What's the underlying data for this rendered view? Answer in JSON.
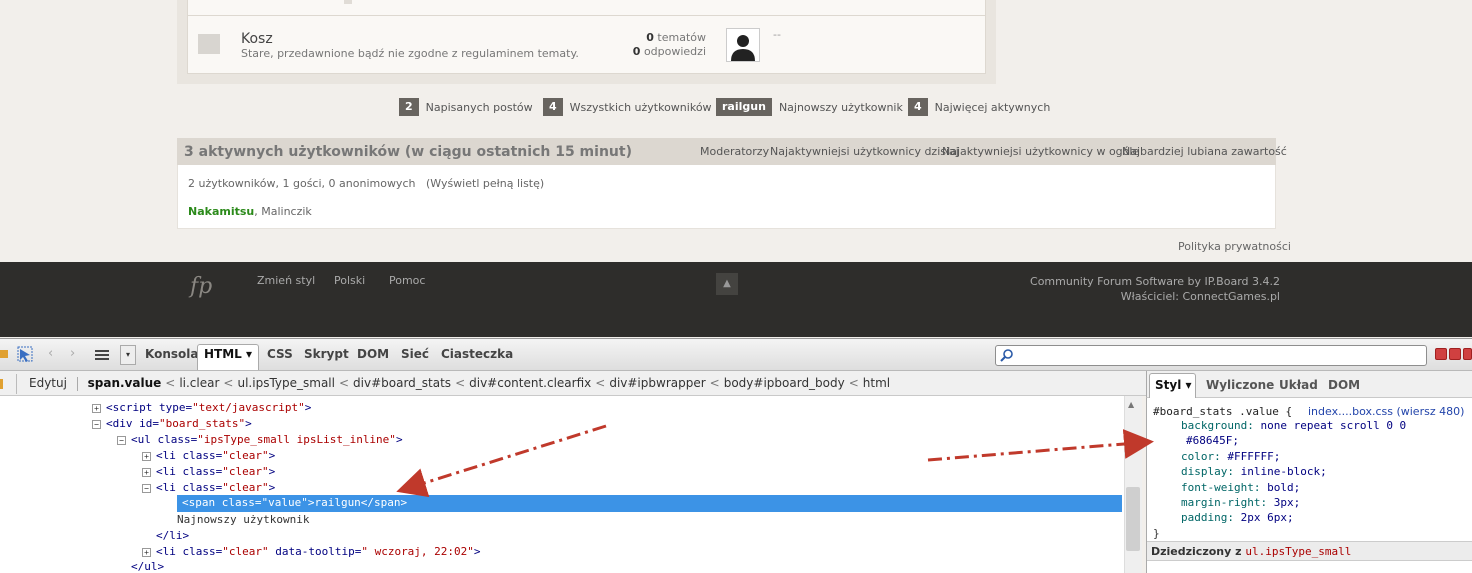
{
  "category": {
    "title": "Kosz",
    "description": "Stare, przedawnione bądź nie zgodne z regulaminem tematy.",
    "topics_count": "0",
    "topics_label": "tematów",
    "replies_count": "0",
    "replies_label": "odpowiedzi",
    "last_post": "--"
  },
  "board_stats": [
    {
      "value": "2",
      "label": "Napisanych postów"
    },
    {
      "value": "4",
      "label": "Wszystkich użytkowników"
    },
    {
      "value": "railgun",
      "label": "Najnowszy użytkownik"
    },
    {
      "value": "4",
      "label": "Najwięcej aktywnych"
    }
  ],
  "active_users": {
    "title": "3 aktywnych użytkowników (w ciągu ostatnich 15 minut)",
    "links": [
      "Moderatorzy",
      "Najaktywniejsi użytkownicy dzisiaj",
      "Najaktywniejsi użytkownicy w ogóle",
      "Najbardziej lubiana zawartość"
    ],
    "count_text": "2 użytkowników, 1 gości, 0 anonimowych",
    "full_list": "(Wyświetl pełną listę)",
    "user1": "Nakamitsu",
    "user2": ", Malinczik"
  },
  "privacy": "Polityka prywatności",
  "footer": {
    "logo": "fp",
    "change_style": "Zmień styl",
    "language": "Polski",
    "help": "Pomoc",
    "top_glyph": "▲",
    "software": "Community Forum Software by IP.Board 3.4.2",
    "owner": "Właściciel: ConnectGames.pl"
  },
  "firebug": {
    "tabs": {
      "console": "Konsola",
      "html": "HTML ▾",
      "css": "CSS",
      "script": "Skrypt",
      "dom": "DOM",
      "net": "Sieć",
      "cookies": "Ciasteczka"
    },
    "edit": "Edytuj",
    "breadcrumb": [
      "span.value",
      "li.clear",
      "ul.ipsType_small",
      "div#board_stats",
      "div#content.clearfix",
      "div#ipbwrapper",
      "body#ipboard_body",
      "html"
    ],
    "side_tabs": {
      "style": "Styl ▾",
      "computed": "Wyliczone",
      "layout": "Układ",
      "dom": "DOM"
    },
    "rule_selector": "#board_stats .value {",
    "rule_source": "index....box.css (wiersz 480)",
    "props": [
      {
        "name": "background:",
        "value": "none repeat scroll 0 0"
      },
      {
        "name": "",
        "value": "#68645F;"
      },
      {
        "name": "color:",
        "value": "#FFFFFF;"
      },
      {
        "name": "display:",
        "value": "inline-block;"
      },
      {
        "name": "font-weight:",
        "value": "bold;"
      },
      {
        "name": "margin-right:",
        "value": "3px;"
      },
      {
        "name": "padding:",
        "value": "2px 6px;"
      }
    ],
    "rule_close": "}",
    "inherited_label": "Dziedziczony z",
    "inherited_from": "ul.ipsType_small",
    "code": {
      "l1_tag": "<script",
      "l1_attr": "type=",
      "l1_val": "\"text/javascript\"",
      "l1_end": ">",
      "l2_tag": "<div",
      "l2_attr": "id=",
      "l2_val": "\"board_stats\"",
      "l2_end": ">",
      "l3_tag": "<ul",
      "l3_attr": "class=",
      "l3_val": "\"ipsType_small ipsList_inline\"",
      "l3_end": ">",
      "li_tag": "<li",
      "li_attr": "class=",
      "li_val": "\"clear\"",
      "li_end": ">",
      "span_line": "<span class=\"value\">railgun</span>",
      "text_line": "Najnowszy użytkownik",
      "li_close": "</li>",
      "l8_tooltip_attr": "data-tooltip=",
      "l8_tooltip_val": "\" wczoraj, 22:02\"",
      "ul_close": "</ul>"
    }
  },
  "colors": {
    "badge": "#68645F",
    "selection": "#3C93E6",
    "arrow": "#C0392B"
  }
}
